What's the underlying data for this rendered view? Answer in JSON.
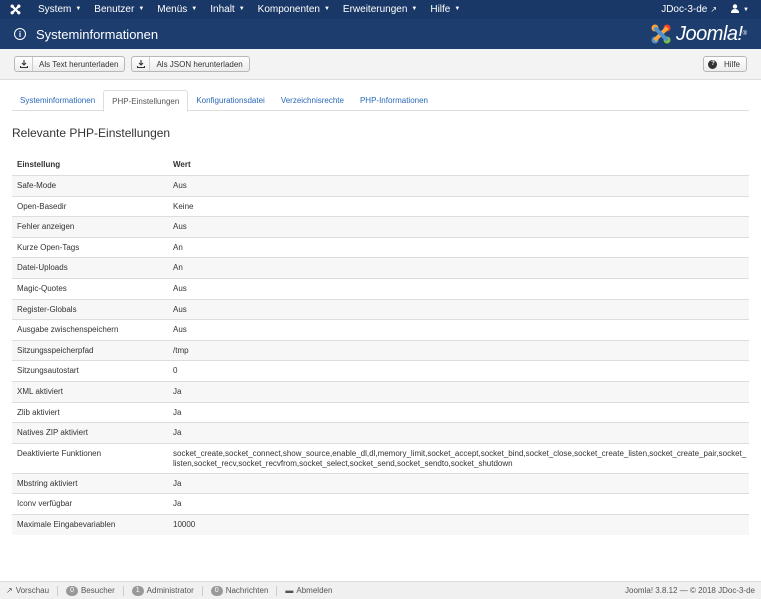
{
  "topnav": {
    "menu": [
      {
        "label": "System"
      },
      {
        "label": "Benutzer"
      },
      {
        "label": "Menüs"
      },
      {
        "label": "Inhalt"
      },
      {
        "label": "Komponenten"
      },
      {
        "label": "Erweiterungen"
      },
      {
        "label": "Hilfe"
      }
    ],
    "site_label": "JDoc-3-de",
    "logo_icon": "joomla-icon",
    "user_icon": "user-icon"
  },
  "header": {
    "title": "Systeminformationen",
    "brand": "Joomla!",
    "brand_registered": "®"
  },
  "toolbar": {
    "download_text_label": "Als Text herunterladen",
    "download_json_label": "Als JSON herunterladen",
    "help_label": "Hilfe"
  },
  "tabs": [
    {
      "label": "Systeminformationen",
      "active": false
    },
    {
      "label": "PHP-Einstellungen",
      "active": true
    },
    {
      "label": "Konfigurationsdatei",
      "active": false
    },
    {
      "label": "Verzeichnisrechte",
      "active": false
    },
    {
      "label": "PHP-Informationen",
      "active": false
    }
  ],
  "section_title": "Relevante PHP-Einstellungen",
  "table": {
    "headers": [
      "Einstellung",
      "Wert"
    ],
    "rows": [
      [
        "Safe-Mode",
        "Aus"
      ],
      [
        "Open-Basedir",
        "Keine"
      ],
      [
        "Fehler anzeigen",
        "Aus"
      ],
      [
        "Kurze Open-Tags",
        "An"
      ],
      [
        "Datei-Uploads",
        "An"
      ],
      [
        "Magic-Quotes",
        "Aus"
      ],
      [
        "Register-Globals",
        "Aus"
      ],
      [
        "Ausgabe zwischenspeichern",
        "Aus"
      ],
      [
        "Sitzungsspeicherpfad",
        "/tmp"
      ],
      [
        "Sitzungsautostart",
        "0"
      ],
      [
        "XML aktiviert",
        "Ja"
      ],
      [
        "Zlib aktiviert",
        "Ja"
      ],
      [
        "Natives ZIP aktiviert",
        "Ja"
      ],
      [
        "Deaktivierte Funktionen",
        "socket_create,socket_connect,show_source,enable_dl,dl,memory_limit,socket_accept,socket_bind,socket_close,socket_create_listen,socket_create_pair,socket_listen,socket_recv,socket_recvfrom,socket_select,socket_send,socket_sendto,socket_shutdown"
      ],
      [
        "Mbstring aktiviert",
        "Ja"
      ],
      [
        "Iconv verfügbar",
        "Ja"
      ],
      [
        "Maximale Eingabevariablen",
        "10000"
      ]
    ]
  },
  "footer": {
    "preview_label": "Vorschau",
    "visitors_count": "0",
    "visitors_label": "Besucher",
    "admins_count": "1",
    "admins_label": "Administrator",
    "messages_count": "0",
    "messages_label": "Nachrichten",
    "logout_label": "Abmelden",
    "copyright": "Joomla! 3.8.12 — © 2018 JDoc-3-de"
  },
  "colors": {
    "topnav_bg": "#1a3867",
    "header_bg": "#1c3d6e",
    "link": "#2a69b8"
  }
}
